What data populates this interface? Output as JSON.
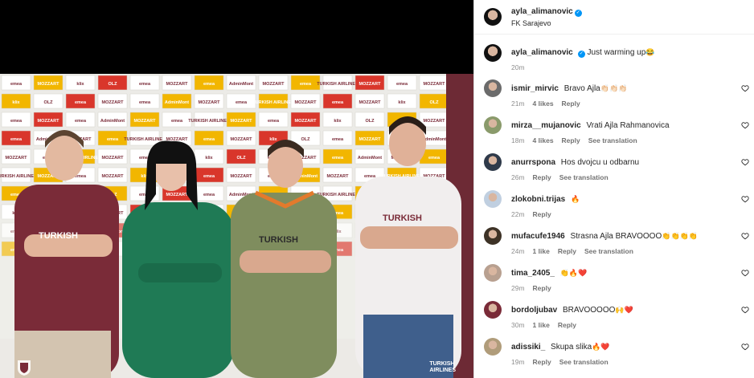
{
  "header": {
    "username": "ayla_alimanovic",
    "location": "FK Sarajevo"
  },
  "caption": {
    "username": "ayla_alimanovic",
    "text": "Just warming up",
    "emoji": "😂",
    "time": "20m"
  },
  "photo": {
    "watermark_line1": "TURKISH",
    "watermark_line2": "AIRLINES",
    "sponsors": [
      "emea",
      "MOZZART",
      "klix",
      "OLZ",
      "emea",
      "MOZZART",
      "emea",
      "AdminMont",
      "MOZZART",
      "emea",
      "TURKISH AIRLINES",
      "MOZZART"
    ]
  },
  "comments": [
    {
      "username": "ismir_mirvic",
      "text": "Bravo Ajla",
      "emoji": "👏🏻👏🏻👏🏻",
      "time": "21m",
      "likes": "4 likes",
      "reply": "Reply",
      "translate": ""
    },
    {
      "username": "mirza__mujanovic",
      "text": "Vrati Ajla Rahmanovica",
      "emoji": "",
      "time": "18m",
      "likes": "4 likes",
      "reply": "Reply",
      "translate": "See translation"
    },
    {
      "username": "anurrspona",
      "text": "Hos dvojcu u odbarnu",
      "emoji": "",
      "time": "26m",
      "likes": "",
      "reply": "Reply",
      "translate": "See translation"
    },
    {
      "username": "zlokobni.trijas",
      "text": "",
      "emoji": "🔥",
      "time": "22m",
      "likes": "",
      "reply": "Reply",
      "translate": ""
    },
    {
      "username": "mufacufe1946",
      "text": "Strasna Ajla BRAVOOOO",
      "emoji": "👏👏👏👏",
      "time": "24m",
      "likes": "1 like",
      "reply": "Reply",
      "translate": "See translation"
    },
    {
      "username": "tima_2405_",
      "text": "",
      "emoji": "👏🔥❤️",
      "time": "29m",
      "likes": "",
      "reply": "Reply",
      "translate": ""
    },
    {
      "username": "bordoljubav",
      "text": "BRAVOOOOO",
      "emoji": "🙌❤️",
      "time": "30m",
      "likes": "1 like",
      "reply": "Reply",
      "translate": ""
    },
    {
      "username": "adissiki_",
      "text": "Skupa slika",
      "emoji": "🔥❤️",
      "time": "19m",
      "likes": "",
      "reply": "Reply",
      "translate": "See translation"
    }
  ],
  "colors": {
    "verified": "#0095f6",
    "maroon": "#6d2a35",
    "muted": "#8e8e8e"
  }
}
